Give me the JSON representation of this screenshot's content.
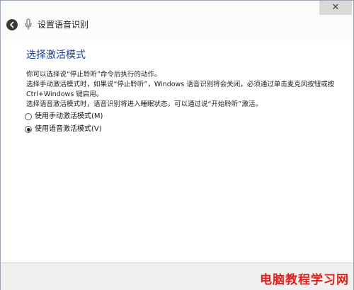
{
  "window": {
    "close_glyph": "✕",
    "title": "设置语音识别"
  },
  "page": {
    "heading": "选择激活模式",
    "description": [
      "你可以选择说“停止聆听”命令后执行的动作。",
      "选择手动激活模式时，如果说“停止聆听”，Windows 语音识别将会关闭，必须通过单击麦克风按钮或按 Ctrl+Windows 键启用。",
      "选择语音激活模式时，语音识别将进入睡眠状态，可以通过说“开始聆听”激活。"
    ],
    "options": [
      {
        "label": "使用手动激活模式(M)",
        "selected": false
      },
      {
        "label": "使用语音激活模式(V)",
        "selected": true
      }
    ]
  },
  "watermark": {
    "text": "电脑教程学习网"
  },
  "colors": {
    "heading": "#1a3f9e",
    "watermark": "#e0201a"
  }
}
